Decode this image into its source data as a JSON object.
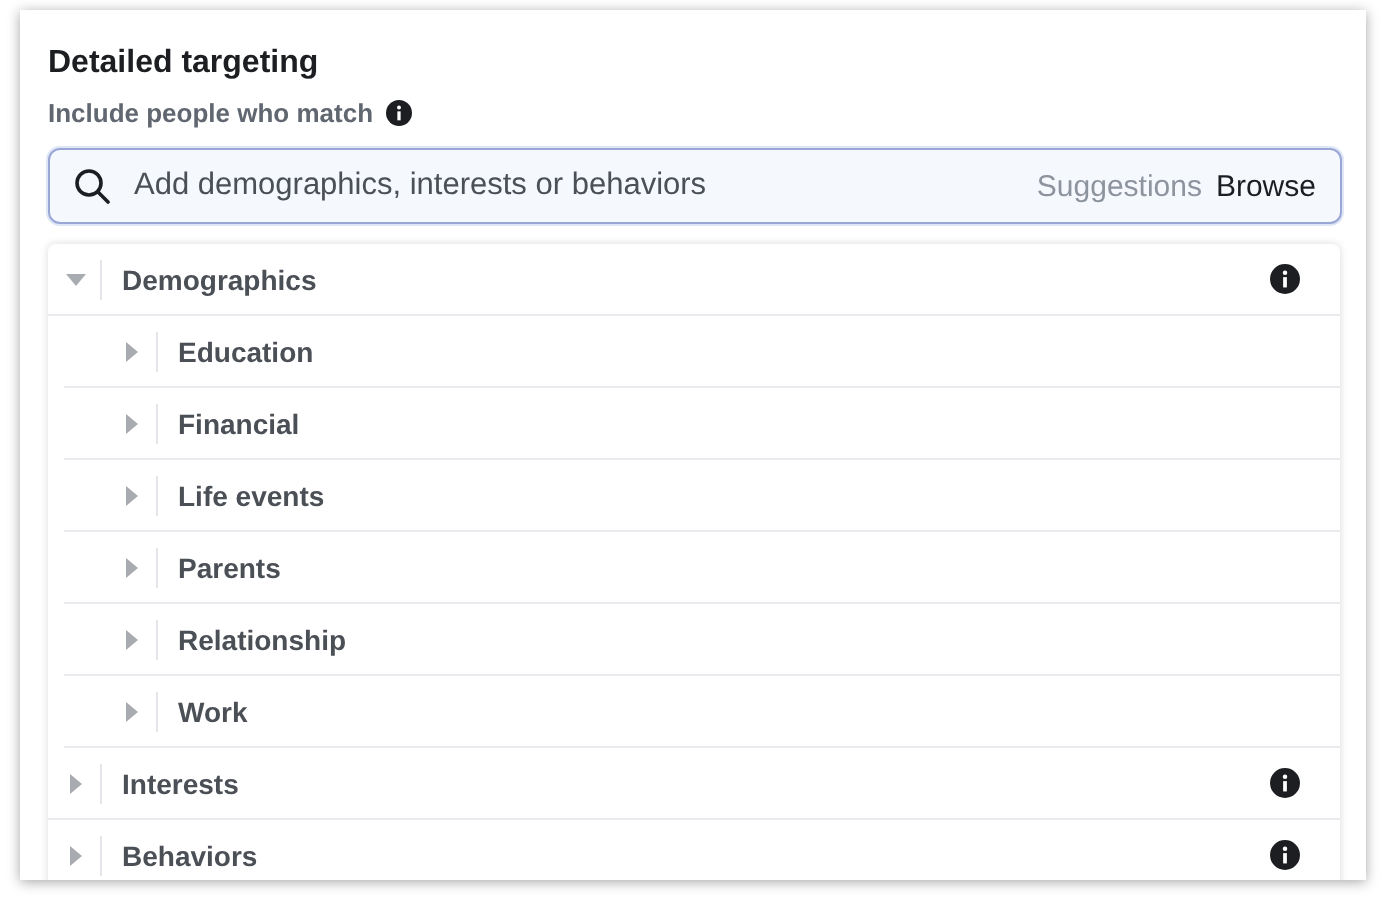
{
  "section": {
    "title": "Detailed targeting",
    "subtitle": "Include people who match"
  },
  "search": {
    "placeholder": "Add demographics, interests or behaviors",
    "suggestions": "Suggestions",
    "browse": "Browse"
  },
  "tree": [
    {
      "label": "Demographics",
      "expanded": true,
      "children": [
        {
          "label": "Education",
          "expanded": false
        },
        {
          "label": "Financial",
          "expanded": false
        },
        {
          "label": "Life events",
          "expanded": false
        },
        {
          "label": "Parents",
          "expanded": false
        },
        {
          "label": "Relationship",
          "expanded": false
        },
        {
          "label": "Work",
          "expanded": false
        }
      ]
    },
    {
      "label": "Interests",
      "expanded": false
    },
    {
      "label": "Behaviors",
      "expanded": false
    }
  ]
}
